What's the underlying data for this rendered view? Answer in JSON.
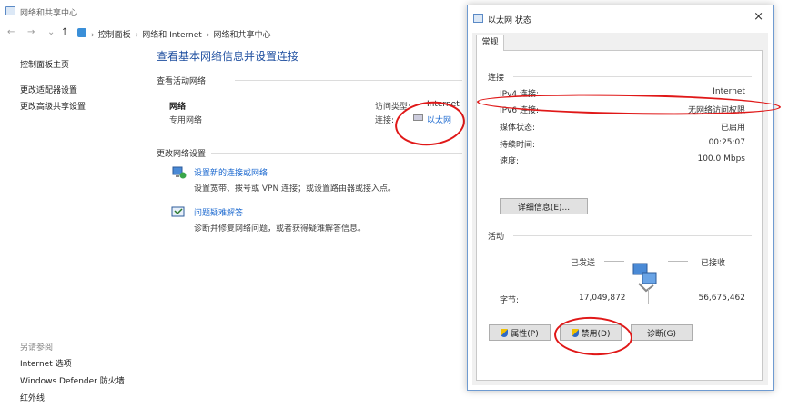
{
  "main_window": {
    "title": "网络和共享中心",
    "breadcrumb": [
      "控制面板",
      "网络和 Internet",
      "网络和共享中心"
    ],
    "nav": {
      "back": "←",
      "forward": "→",
      "dropdown": "⌄",
      "up": "↑"
    },
    "sidebar": {
      "links": [
        "控制面板主页",
        "更改适配器设置",
        "更改高级共享设置"
      ],
      "see_also_heading": "另请参阅",
      "see_also": [
        "Internet 选项",
        "Windows Defender 防火墙",
        "红外线"
      ]
    },
    "content": {
      "title": "查看基本网络信息并设置连接",
      "active_networks_label": "查看活动网络",
      "network_name": "网络",
      "network_type": "专用网络",
      "access_type_label": "访问类型:",
      "access_type_value": "Internet",
      "connections_label": "连接:",
      "connections_value": "以太网",
      "change_settings_label": "更改网络设置",
      "tasks": [
        {
          "link": "设置新的连接或网络",
          "desc": "设置宽带、拨号或 VPN 连接；或设置路由器或接入点。"
        },
        {
          "link": "问题疑难解答",
          "desc": "诊断并修复网络问题，或者获得疑难解答信息。"
        }
      ]
    }
  },
  "dialog": {
    "title": "以太网 状态",
    "close": "×",
    "tab": "常规",
    "connection": {
      "group_label": "连接",
      "rows": [
        {
          "label": "IPv4 连接:",
          "value": "Internet"
        },
        {
          "label": "IPv6 连接:",
          "value": "无网络访问权限"
        },
        {
          "label": "媒体状态:",
          "value": "已启用"
        },
        {
          "label": "持续时间:",
          "value": "00:25:07"
        },
        {
          "label": "速度:",
          "value": "100.0 Mbps"
        }
      ],
      "details_button": "详细信息(E)..."
    },
    "activity": {
      "group_label": "活动",
      "sent_label": "已发送",
      "received_label": "已接收",
      "bytes_label": "字节:",
      "bytes_sent": "17,049,872",
      "bytes_received": "56,675,462"
    },
    "buttons": {
      "properties": "属性(P)",
      "disable": "禁用(D)",
      "diagnose": "诊断(G)"
    }
  },
  "colors": {
    "link": "#1f6bd0",
    "title_blue": "#1f4fa0",
    "annotation_red": "#e01818",
    "dialog_border": "#6f9bd1"
  }
}
